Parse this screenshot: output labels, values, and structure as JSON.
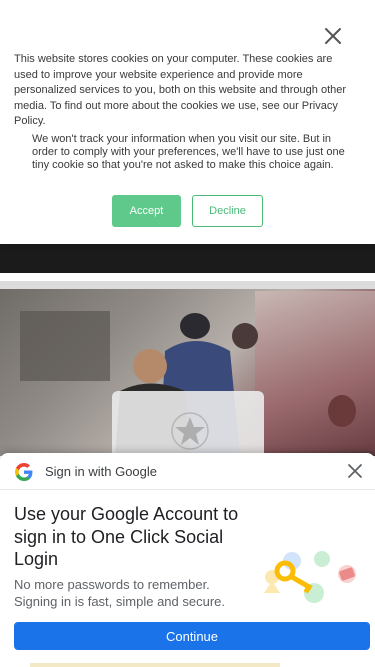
{
  "cookie_banner": {
    "message": "This website stores cookies on your computer. These cookies are used to improve your website experience and provide more personalized services to you, both on this website and through other media. To find out more about the cookies we use, see our Privacy Policy.",
    "tracking_notice": "We won't track your information when you visit our site. But in order to comply with your preferences, we'll have to use just one tiny cookie so that you're not asked to make this choice again.",
    "accept_label": "Accept",
    "decline_label": "Decline",
    "close_icon": "close-icon",
    "accent_color": "#5ec98a"
  },
  "google_signin": {
    "header_title": "Sign in with Google",
    "heading": "Use your Google Account to sign in to One Click Social Login",
    "description": "No more passwords to remember. Signing in is fast, simple and secure.",
    "continue_label": "Continue",
    "logo_icon": "google-logo-icon",
    "close_icon": "close-icon",
    "button_color": "#1a73e8"
  }
}
